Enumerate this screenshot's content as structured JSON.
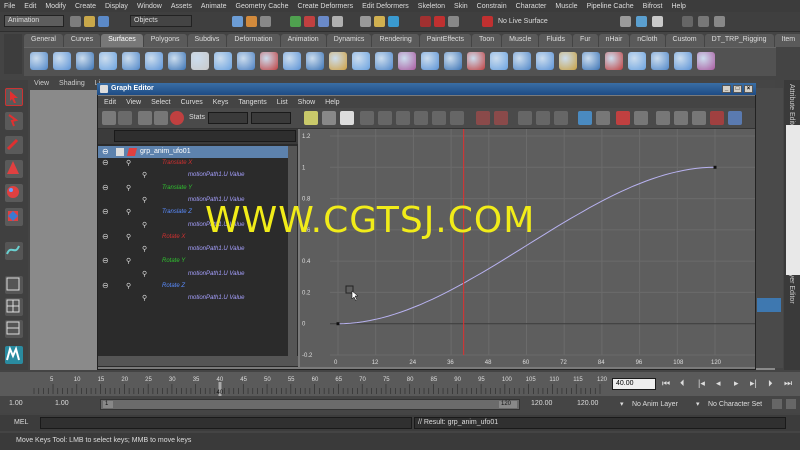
{
  "menubar": [
    "File",
    "Edit",
    "Modify",
    "Create",
    "Display",
    "Window",
    "Assets",
    "Animate",
    "Geometry Cache",
    "Create Deformers",
    "Edit Deformers",
    "Skeleton",
    "Skin",
    "Constrain",
    "Character",
    "Muscle",
    "Pipeline Cache",
    "Bifrost",
    "Help"
  ],
  "status": {
    "mode": "Animation",
    "objects_label": "Objects",
    "live_surface": "No Live Surface"
  },
  "shelf_tabs": [
    "General",
    "Curves",
    "Surfaces",
    "Polygons",
    "Subdivs",
    "Deformation",
    "Animation",
    "Dynamics",
    "Rendering",
    "PaintEffects",
    "Toon",
    "Muscle",
    "Fluids",
    "Fur",
    "nHair",
    "nCloth",
    "Custom",
    "DT_TRP_Rigging",
    "Item"
  ],
  "active_shelf": "Surfaces",
  "panel_menu": [
    "View",
    "Shading",
    "Li"
  ],
  "graph_editor": {
    "title": "Graph Editor",
    "menu": [
      "Edit",
      "View",
      "Select",
      "Curves",
      "Keys",
      "Tangents",
      "List",
      "Show",
      "Help"
    ],
    "stats_label": "Stats"
  },
  "outliner": {
    "root": "grp_anim_ufo01",
    "items": [
      {
        "label": "Translate X",
        "color": "#d03030",
        "indent": 1
      },
      {
        "label": "motionPath1.U Value",
        "color": "#a6a0ff",
        "indent": 2
      },
      {
        "label": "Translate Y",
        "color": "#30c030",
        "indent": 1
      },
      {
        "label": "motionPath1.U Value",
        "color": "#a6a0ff",
        "indent": 2
      },
      {
        "label": "Translate Z",
        "color": "#5a8cff",
        "indent": 1
      },
      {
        "label": "motionPath1.U Value",
        "color": "#a6a0ff",
        "indent": 2
      },
      {
        "label": "Rotate X",
        "color": "#d03030",
        "indent": 1
      },
      {
        "label": "motionPath1.U Value",
        "color": "#a6a0ff",
        "indent": 2
      },
      {
        "label": "Rotate Y",
        "color": "#30c030",
        "indent": 1
      },
      {
        "label": "motionPath1.U Value",
        "color": "#a6a0ff",
        "indent": 2
      },
      {
        "label": "Rotate Z",
        "color": "#5a8cff",
        "indent": 1
      },
      {
        "label": "motionPath1.U Value",
        "color": "#a6a0ff",
        "indent": 2
      }
    ]
  },
  "graph": {
    "y_ticks": [
      "1.2",
      "1",
      "0.8",
      "0.6",
      "0.4",
      "0.2",
      "0",
      "-0.2"
    ],
    "x_ticks": [
      "0",
      "12",
      "24",
      "36",
      "48",
      "60",
      "72",
      "84",
      "96",
      "108",
      "120"
    ],
    "curve_color": "#b8b2f0",
    "current_time_frame": 40
  },
  "timeline": {
    "ticks": [
      "5",
      "10",
      "15",
      "20",
      "25",
      "30",
      "35",
      "40",
      "45",
      "50",
      "55",
      "60",
      "65",
      "70",
      "75",
      "80",
      "85",
      "90",
      "95",
      "100",
      "105",
      "110",
      "115",
      "120"
    ],
    "current_frame": "40.00",
    "current_marker": "40"
  },
  "range": {
    "start": "1.00",
    "playback_start": "1.00",
    "slider_start": "1",
    "slider_end": "120",
    "playback_end": "120.00",
    "end": "120.00",
    "anim_layer": "No Anim Layer",
    "character_set": "No Character Set"
  },
  "cmd": {
    "label": "MEL",
    "result": "// Result: grp_anim_ufo01"
  },
  "help": "Move Keys Tool: LMB to select keys; MMB to move keys",
  "right_tabs": [
    "Attribute Editor",
    "Channel Box / Layer Editor"
  ],
  "watermark": "WWW.CGTSJ.COM"
}
